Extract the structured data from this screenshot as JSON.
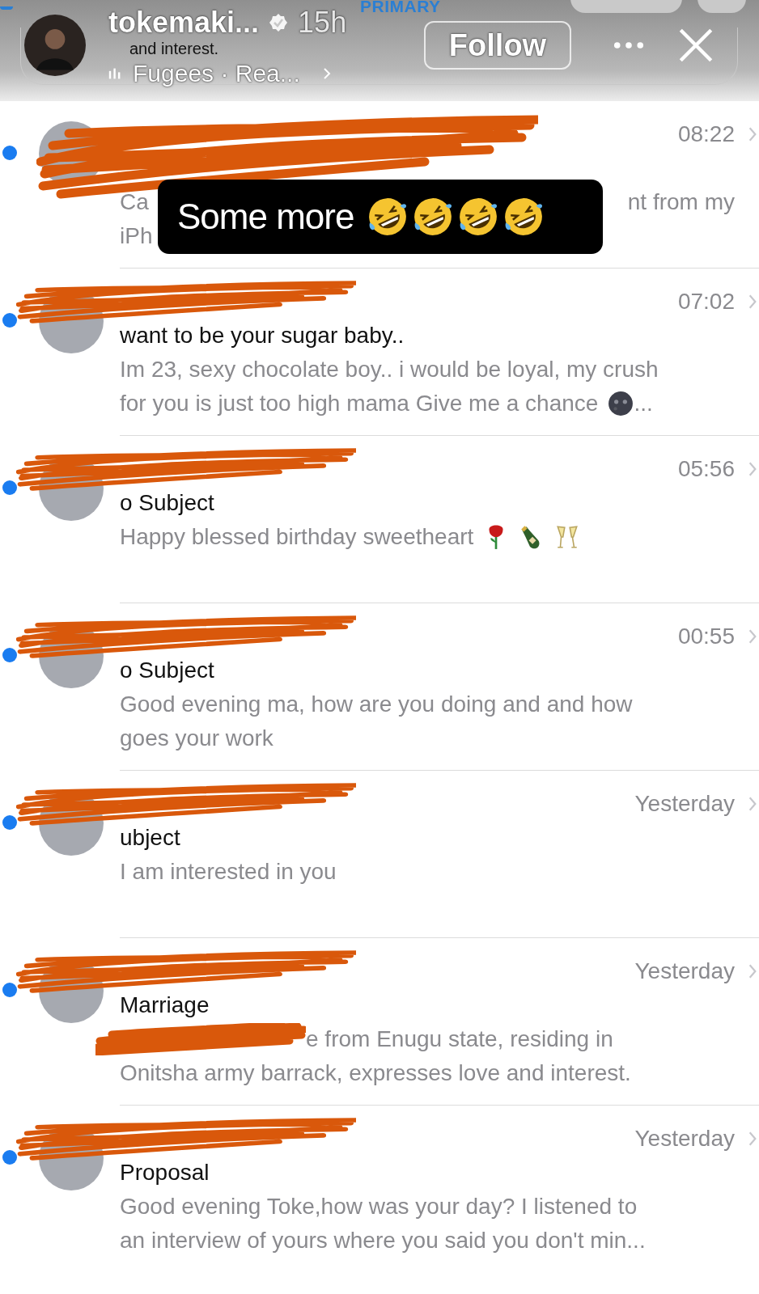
{
  "mail_header": {
    "title": "PRIMARY",
    "peek_text": "and interest."
  },
  "story": {
    "username": "tokemaki...",
    "verified": true,
    "time": "15h",
    "music": "Fugees · Rea...",
    "follow": "Follow"
  },
  "sticker": {
    "text": "Some more",
    "emojis": [
      {
        "kind": "rofl"
      },
      {
        "kind": "rofl"
      },
      {
        "kind": "rofl"
      },
      {
        "kind": "rofl"
      }
    ]
  },
  "messages": [
    {
      "unread": true,
      "time": "08:22",
      "preview": [
        [
          {
            "kind": "text",
            "text": "Ca"
          },
          {
            "kind": "sticker_gap"
          },
          {
            "kind": "text",
            "text": "nt from my"
          }
        ],
        [
          {
            "kind": "text",
            "text": "iPh"
          }
        ]
      ]
    },
    {
      "unread": true,
      "time": "07:02",
      "subject": "want to be your sugar baby..",
      "preview": [
        [
          {
            "kind": "text",
            "text": "Im 23, sexy chocolate boy.. i would be loyal, my crush"
          }
        ],
        [
          {
            "kind": "text",
            "text": "for you is just too high mama Give me a chance"
          },
          {
            "kind": "moon"
          },
          {
            "kind": "text",
            "text": "..."
          }
        ]
      ]
    },
    {
      "unread": true,
      "time": "05:56",
      "subject": "o Subject",
      "preview": [
        [
          {
            "kind": "text",
            "text": "Happy blessed birthday sweetheart"
          },
          {
            "kind": "rose"
          },
          {
            "kind": "bottle"
          },
          {
            "kind": "glasses"
          }
        ]
      ]
    },
    {
      "unread": true,
      "time": "00:55",
      "subject": "o Subject",
      "preview": [
        [
          {
            "kind": "text",
            "text": "Good evening ma, how are you doing and and how"
          }
        ],
        [
          {
            "kind": "text",
            "text": "goes your work"
          }
        ]
      ]
    },
    {
      "unread": true,
      "time": "Yesterday",
      "subject": "ubject",
      "preview": [
        [
          {
            "kind": "text",
            "text": "I am interested in you"
          }
        ]
      ]
    },
    {
      "unread": true,
      "time": "Yesterday",
      "subject": "Marriage",
      "preview": [
        [
          {
            "kind": "scribble_gap"
          },
          {
            "kind": "text",
            "text": "e from Enugu state, residing in"
          }
        ],
        [
          {
            "kind": "text",
            "text": "Onitsha army barrack, expresses love and interest."
          }
        ]
      ]
    },
    {
      "unread": true,
      "time": "Yesterday",
      "subject": "Proposal",
      "preview": [
        [
          {
            "kind": "text",
            "text": "Good evening Toke,how was your day? I listened to"
          }
        ],
        [
          {
            "kind": "text",
            "text": "an interview of yours where you said you don't min..."
          }
        ]
      ]
    }
  ]
}
